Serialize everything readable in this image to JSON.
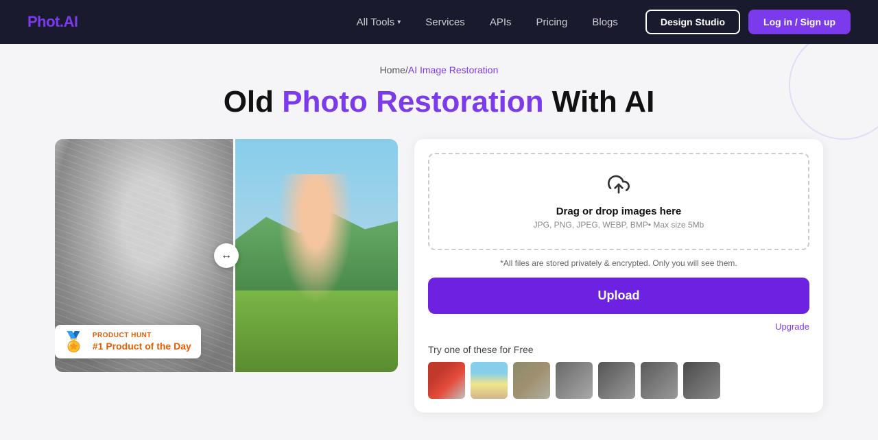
{
  "navbar": {
    "logo_text": "Phot",
    "logo_dot": ".",
    "logo_ai": "AI",
    "nav_links": [
      {
        "id": "all-tools",
        "label": "All Tools",
        "has_dropdown": true
      },
      {
        "id": "services",
        "label": "Services",
        "has_dropdown": false
      },
      {
        "id": "apis",
        "label": "APIs",
        "has_dropdown": false
      },
      {
        "id": "pricing",
        "label": "Pricing",
        "has_dropdown": false
      },
      {
        "id": "blogs",
        "label": "Blogs",
        "has_dropdown": false
      }
    ],
    "btn_design_studio": "Design Studio",
    "btn_login": "Log in / Sign up"
  },
  "breadcrumb": {
    "home": "Home",
    "separator": "/",
    "current": "AI Image Restoration"
  },
  "page_title": {
    "prefix": "Old ",
    "highlight": "Photo Restoration",
    "suffix": " With AI"
  },
  "upload_panel": {
    "drop_text": "Drag or drop images here",
    "drop_subtext": "JPG, PNG, JPEG, WEBP, BMP• Max size 5Mb",
    "privacy_note": "*All files are stored privately & encrypted. Only you will see them.",
    "upload_btn": "Upload",
    "upgrade_link": "Upgrade",
    "try_free_label": "Try one of these for Free",
    "sample_count": 7
  },
  "product_hunt": {
    "label": "PRODUCT HUNT",
    "title": "#1 Product of the Day",
    "medal": "🏅"
  },
  "divider_handle": "↔"
}
